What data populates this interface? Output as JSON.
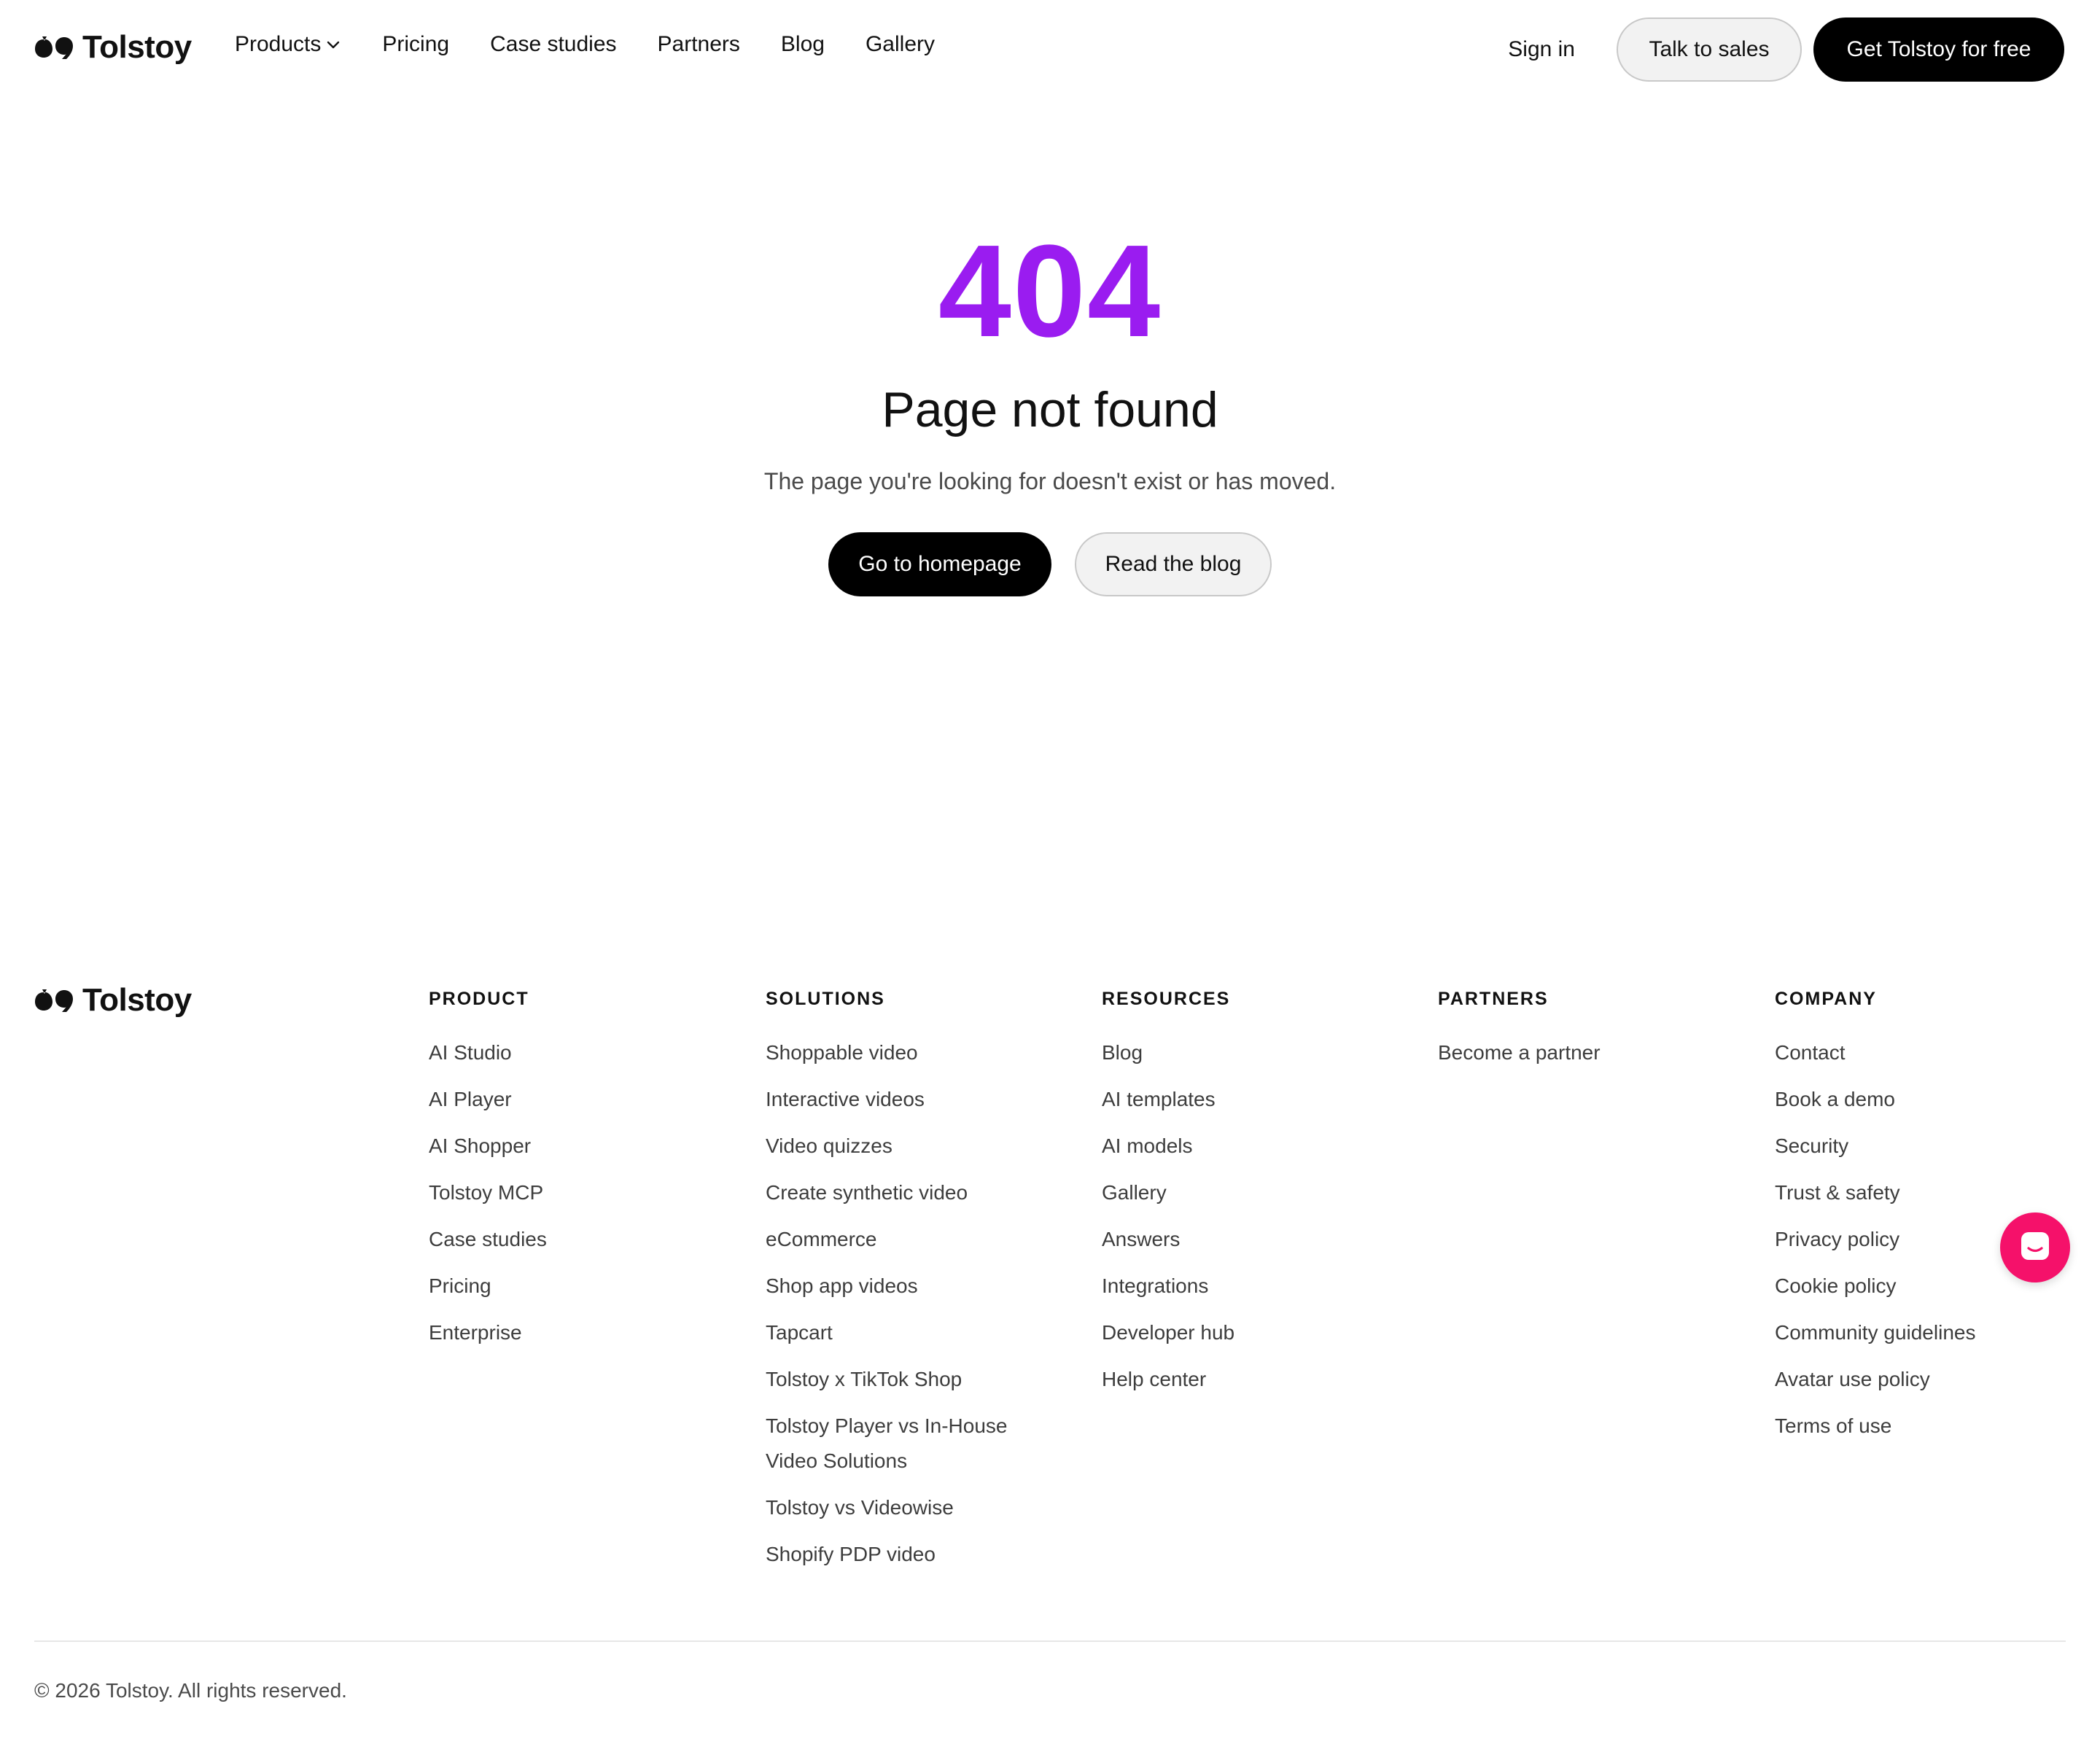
{
  "brand": {
    "name": "Tolstoy"
  },
  "nav": {
    "items": [
      {
        "label": "Products"
      },
      {
        "label": "Pricing"
      },
      {
        "label": "Case studies"
      },
      {
        "label": "Partners"
      },
      {
        "label": "Blog"
      },
      {
        "label": "Gallery"
      }
    ],
    "sign_in": "Sign in",
    "talk_to_sales": "Talk to sales",
    "get_free": "Get Tolstoy for free"
  },
  "hero": {
    "code": "404",
    "title": "Page not found",
    "subtitle": "The page you're looking for doesn't exist or has moved.",
    "primary_button": "Go to homepage",
    "secondary_button": "Read the blog"
  },
  "footer": {
    "columns": [
      {
        "heading": "PRODUCT",
        "links": [
          "AI Studio",
          "AI Player",
          "AI Shopper",
          "Tolstoy MCP",
          "Case studies",
          "Pricing",
          "Enterprise"
        ]
      },
      {
        "heading": "SOLUTIONS",
        "links": [
          "Shoppable video",
          "Interactive videos",
          "Video quizzes",
          "Create synthetic video",
          "eCommerce",
          "Shop app videos",
          "Tapcart",
          "Tolstoy x TikTok Shop",
          "Tolstoy Player vs In-House Video Solutions",
          "Tolstoy vs Videowise",
          "Shopify PDP video"
        ]
      },
      {
        "heading": "RESOURCES",
        "links": [
          "Blog",
          "AI templates",
          "AI models",
          "Gallery",
          "Answers",
          "Integrations",
          "Developer hub",
          "Help center"
        ]
      },
      {
        "heading": "PARTNERS",
        "links": [
          "Become a partner"
        ]
      },
      {
        "heading": "COMPANY",
        "links": [
          "Contact",
          "Book a demo",
          "Security",
          "Trust & safety",
          "Privacy policy",
          "Cookie policy",
          "Community guidelines",
          "Avatar use policy",
          "Terms of use"
        ]
      }
    ],
    "copyright": "© 2026 Tolstoy. All rights reserved."
  },
  "colors": {
    "accent": "#9a1cf0",
    "chat": "#f5116a",
    "dark": "#000000"
  },
  "icons": {
    "logo": "quote-marks-icon",
    "products_dropdown": "chevron-down-icon",
    "chat": "chat-bubble-icon"
  }
}
